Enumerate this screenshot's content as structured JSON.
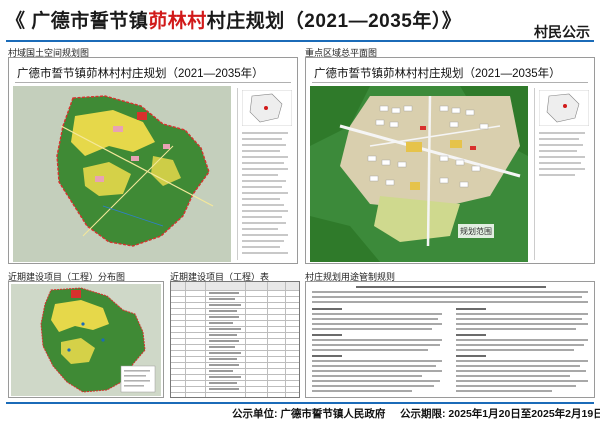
{
  "header": {
    "title_prefix": "《 广德市誓节镇",
    "title_highlight": "茆林村",
    "title_suffix": "村庄规划（2021—2035年）》",
    "notice_tag": "村民公示"
  },
  "sections": {
    "territorial_map": "村域国土空间规划图",
    "key_area_plan": "重点区域总平面图",
    "recent_projects_map": "近期建设项目（工程）分布图",
    "recent_projects_table": "近期建设项目（工程）表",
    "land_use_rules": "村庄规划用途管制规则"
  },
  "panels": {
    "territorial_title": "广德市誓节镇茆林村村庄规划（2021—2035年）",
    "key_area_title": "广德市誓节镇茆林村村庄规划（2021—2035年）",
    "key_area_stamp": "规划范围"
  },
  "footer": {
    "unit_label": "公示单位:",
    "unit_value": "广德市誓节镇人民政府",
    "period_label": "公示期限:",
    "period_value": "2025年1月20日至2025年2月19日"
  },
  "colors": {
    "accent_blue": "#1b6bb8",
    "highlight_red": "#d11a1a",
    "forest_green": "#2f7a2a",
    "farmland_yellow": "#e6d84a",
    "village_pink": "#e8a2b4",
    "construction_red": "#d8312d"
  }
}
